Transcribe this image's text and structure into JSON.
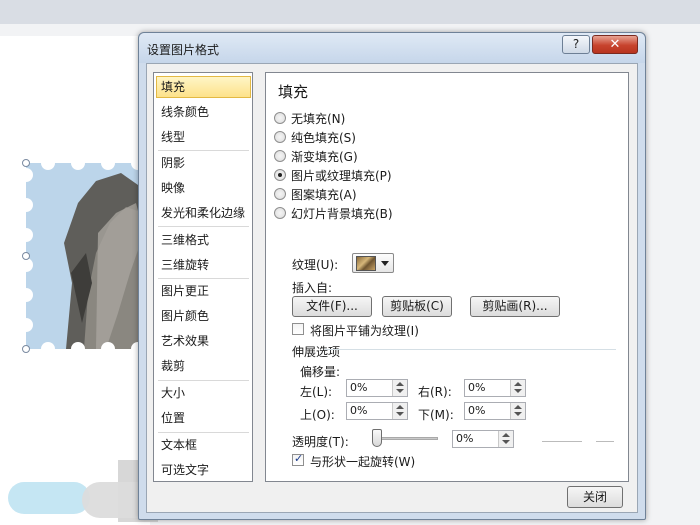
{
  "dialog": {
    "title": "设置图片格式",
    "help": "?",
    "close_glyph": "✕",
    "close_button": "关闭"
  },
  "nav": {
    "items": [
      "填充",
      "线条颜色",
      "线型",
      "阴影",
      "映像",
      "发光和柔化边缘",
      "三维格式",
      "三维旋转",
      "图片更正",
      "图片颜色",
      "艺术效果",
      "裁剪",
      "大小",
      "位置",
      "文本框",
      "可选文字"
    ],
    "selected": "填充"
  },
  "fill": {
    "heading": "填充",
    "options": [
      "无填充(N)",
      "纯色填充(S)",
      "渐变填充(G)",
      "图片或纹理填充(P)",
      "图案填充(A)",
      "幻灯片背景填充(B)"
    ],
    "selected": "图片或纹理填充(P)",
    "texture_label": "纹理(U):",
    "insert_from": "插入自:",
    "buttons": {
      "file": "文件(F)...",
      "clipboard": "剪贴板(C)",
      "clipart": "剪贴画(R)..."
    },
    "tile_label": "将图片平铺为纹理(I)",
    "tile_checked": false,
    "stretch_options": "伸展选项",
    "offset": "偏移量:",
    "left": {
      "label": "左(L):",
      "value": "0%"
    },
    "right": {
      "label": "右(R):",
      "value": "0%"
    },
    "top": {
      "label": "上(O):",
      "value": "0%"
    },
    "bottom": {
      "label": "下(M):",
      "value": "0%"
    },
    "transparency": {
      "label": "透明度(T):",
      "value": "0%",
      "level": 0
    },
    "rotate_label": "与形状一起旋转(W)",
    "rotate_checked": true
  },
  "colors": {
    "nav_selected": "#fde28a",
    "close_red": "#c7432d",
    "frame": "#cfdcec"
  }
}
